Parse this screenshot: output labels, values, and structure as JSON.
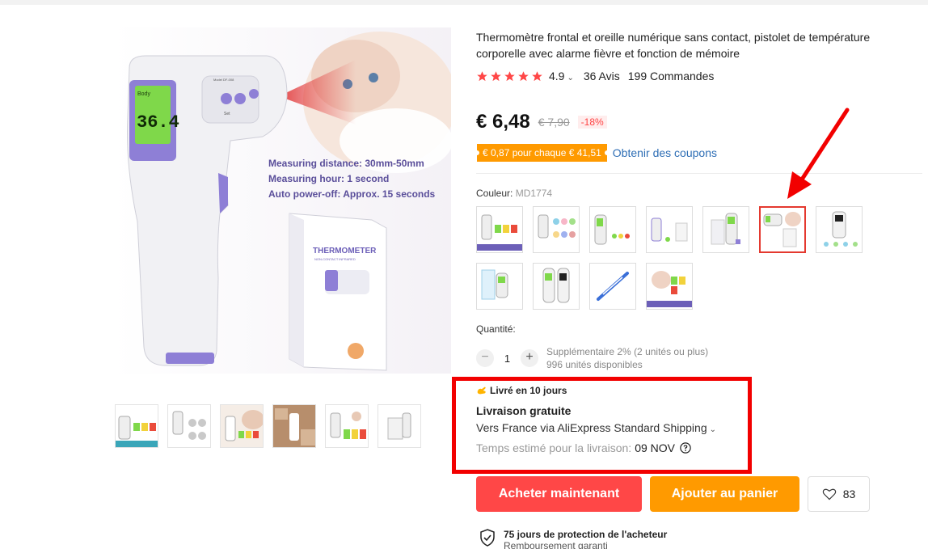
{
  "product": {
    "title": "Thermomètre frontal et oreille numérique sans contact, pistolet de température corporelle avec alarme fièvre et fonction de mémoire",
    "rating": "4.9",
    "reviews": "36 Avis",
    "orders": "199 Commandes"
  },
  "main_image": {
    "screen_reading": "36.4",
    "screen_tag": "Body",
    "device_model": "Model DF-008",
    "button_label": "Set",
    "caption_lines": [
      "Measuring distance: 30mm-50mm",
      "Measuring hour: 1 second",
      "Auto power-off: Approx. 15 seconds"
    ],
    "box_title": "THERMOMETER",
    "box_subtitle": "NON-CONTACT INFRARED"
  },
  "price": {
    "current": "€ 6,48",
    "original": "€ 7,90",
    "discount": "-18%"
  },
  "coupon": {
    "badge": "€ 0,87 pour chaque € 41,51",
    "link": "Obtenir des coupons"
  },
  "color": {
    "label": "Couleur:",
    "selected_value": "MD1774",
    "selected_index": 5,
    "count": 11
  },
  "quantity": {
    "label": "Quantité:",
    "minus": "−",
    "value": "1",
    "plus": "+",
    "extra": "Supplémentaire 2% (2 unités ou plus)",
    "available": "996 unités disponibles"
  },
  "shipping": {
    "delivery_tag": "Livré en 10 jours",
    "free": "Livraison gratuite",
    "route": "Vers France via AliExpress Standard Shipping",
    "eta_label": "Temps estimé pour la livraison:",
    "eta_date": "09 NOV"
  },
  "actions": {
    "buy": "Acheter maintenant",
    "cart": "Ajouter au panier",
    "wish_count": "83"
  },
  "protection": {
    "title": "75 jours de protection de l'acheteur",
    "subtitle": "Remboursement garanti"
  },
  "colors": {
    "accent": "#ff4747",
    "orange": "#ff9a00",
    "link": "#2e6eb5",
    "highlight": "#f20000",
    "device_purple": "#8e7fd6"
  }
}
